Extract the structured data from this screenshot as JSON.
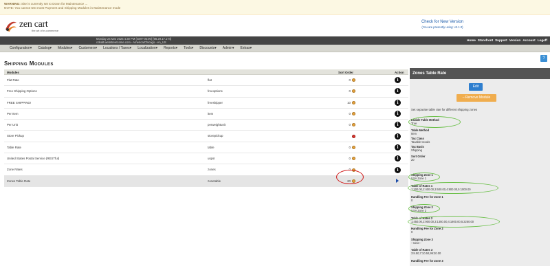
{
  "warning": {
    "label": "WARNING:",
    "line1": "Site is currently set to Down for Maintenance ...",
    "line2": "NOTE: You cannot test most Payment and Shipping Modules in Maintenance mode"
  },
  "logo": {
    "name": "zen cart",
    "tagline": "the art of e-commerce"
  },
  "version_check": {
    "link": "Check for New Version",
    "status": "(You are presently using: v2.1.0)"
  },
  "server_info": {
    "line1": "Monday 24 Mar 2025 4:30 PM (GMT-05:00) [98.29.17.174]",
    "line2": "cobalt.webstreetcome.com - America/Chicago - en_US"
  },
  "top_links": [
    "Home",
    "Storefront",
    "Support",
    "Version",
    "Account",
    "Logoff"
  ],
  "menu": [
    "Configuration▾",
    "Catalog▾",
    "Modules▾",
    "Customers▾",
    "Locations / Taxes▾",
    "Localization▾",
    "Reports▾",
    "Tools▾",
    "Discounts▾",
    "Admin▾",
    "Extras▾"
  ],
  "help_label": "?",
  "page_title": "Shipping Modules",
  "table": {
    "headers": {
      "modules": "Modules",
      "sort": "Sort Order",
      "action": "Action"
    },
    "rows": [
      {
        "name": "Flat Rate",
        "code": "flat",
        "sort": "0",
        "status": "orange",
        "action": "i"
      },
      {
        "name": "Free Shipping Options",
        "code": "freeoptions",
        "sort": "0",
        "status": "orange",
        "action": "i"
      },
      {
        "name": "FREE SHIPPING!",
        "code": "freeshipper",
        "sort": "10",
        "status": "orange",
        "action": "i"
      },
      {
        "name": "Per Item",
        "code": "item",
        "sort": "0",
        "status": "orange",
        "action": "i"
      },
      {
        "name": "Per Unit",
        "code": "perweightunit",
        "sort": "0",
        "status": "orange",
        "action": "i"
      },
      {
        "name": "Store Pickup",
        "code": "storepickup",
        "sort": "",
        "status": "red",
        "action": "i"
      },
      {
        "name": "Table Rate",
        "code": "table",
        "sort": "0",
        "status": "orange",
        "action": "i"
      },
      {
        "name": "United States Postal Service (RESTful)",
        "code": "uspsr",
        "sort": "0",
        "status": "orange",
        "action": "i"
      },
      {
        "name": "Zone Rates",
        "code": "zones",
        "sort": "0",
        "status": "orange",
        "action": "i"
      },
      {
        "name": "Zones Table Rate",
        "code": "zonetable",
        "sort": "20",
        "status": "orange",
        "action": "arrow"
      }
    ]
  },
  "colors": {
    "orange": "#e8a33b",
    "red": "#d9342b"
  },
  "side": {
    "title": "Zones Table Rate",
    "edit": "Edit",
    "remove": "– Remove Module",
    "desc": "Set separate table rate for different shipping zones",
    "config": [
      {
        "k": "Enable Table Method",
        "v": "True"
      },
      {
        "k": "Table Method",
        "v": "Item"
      },
      {
        "k": "Tax Class",
        "v": "Taxable Goods"
      },
      {
        "k": "Tax Basis",
        "v": "Shipping"
      },
      {
        "k": "Sort Order",
        "v": "20"
      },
      {
        "k": "Shipping Zone 1",
        "v": "USA Zone 1"
      },
      {
        "k": "Table of Rates 1",
        "v": "1:200.00,2:400.00,3:600.00,4:800.00,5:1000.00"
      },
      {
        "k": "Handling Fee for Zone 1",
        "v": "0"
      },
      {
        "k": "Shipping Zone 2",
        "v": "USA Zone 2"
      },
      {
        "k": "Table of Rates 2",
        "v": "1:450.00,2:900.00,3:1350.00,4:1800.00,5:2250.00"
      },
      {
        "k": "Handling Fee for Zone 2",
        "v": "0"
      },
      {
        "k": "Shipping Zone 3",
        "v": "--none--"
      },
      {
        "k": "Table of Rates 3",
        "v": "3:8.50,7:10.50,99:20.00"
      },
      {
        "k": "Handling Fee for Zone 3",
        "v": ""
      }
    ]
  }
}
